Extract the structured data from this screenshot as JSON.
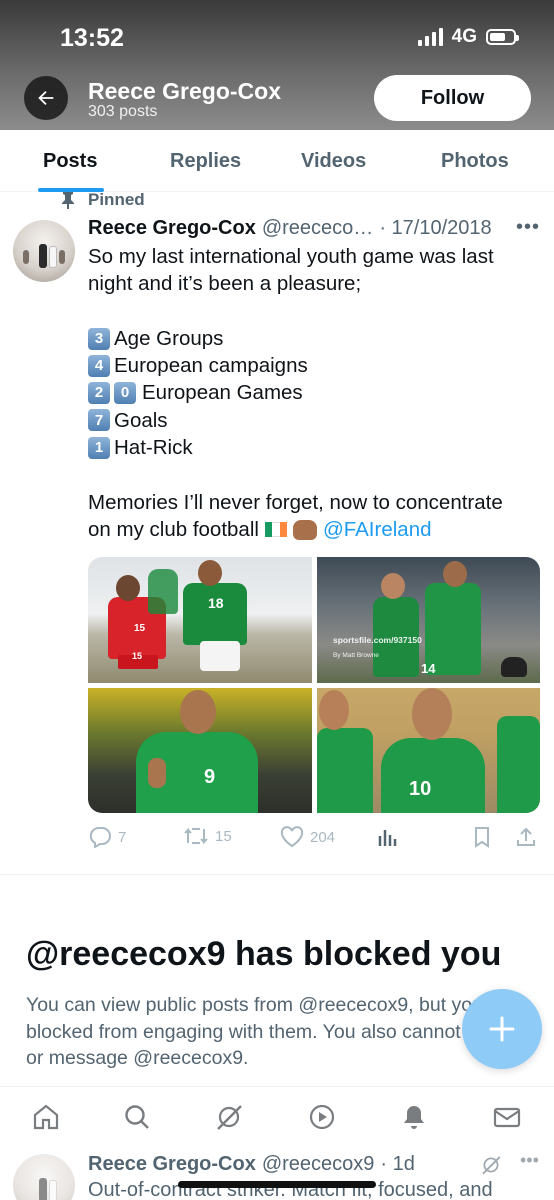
{
  "status_bar": {
    "time": "13:52",
    "network": "4G"
  },
  "header": {
    "name": "Reece Grego-Cox",
    "posts_count": "303 posts",
    "follow_label": "Follow"
  },
  "tabs": [
    {
      "label": "Posts",
      "active": true
    },
    {
      "label": "Replies",
      "active": false
    },
    {
      "label": "Videos",
      "active": false
    },
    {
      "label": "Photos",
      "active": false
    }
  ],
  "pinned_tweet": {
    "pinned_label": "Pinned",
    "author_name": "Reece Grego-Cox",
    "handle": "@reececo…",
    "date": "· 17/10/2018",
    "text_lines": {
      "l1": "So my last international youth game was last",
      "l2": "night and it’s been a pleasure;",
      "l3_num": "3",
      "l3": "Age Groups",
      "l4_num": "4",
      "l4": "European campaigns",
      "l5_num_a": "2",
      "l5_num_b": "0",
      "l5": "European Games",
      "l6_num": "7",
      "l6": "Goals",
      "l7_num": "1",
      "l7": "Hat-Rick",
      "l8": "Memories I’ll never forget, now to concentrate",
      "l9": "on my club football",
      "mention": "@FAIreland"
    },
    "media": {
      "photo1_numbers": [
        "15",
        "18",
        "15"
      ],
      "photo2_watermark": "sportsfile.com/937150",
      "photo2_credit": "By Matt Browne",
      "photo2_number": "14",
      "photo3_number": "9",
      "photo4_number": "10"
    },
    "stats": {
      "replies": "7",
      "reposts": "15",
      "likes": "204"
    }
  },
  "blocked_notice": {
    "title": "@reececox9 has blocked you",
    "body": "You can view public posts from @reececox9, but you are blocked from engaging with them. You also cannot follow or message @reececox9."
  },
  "next_tweet": {
    "author_name": "Reece Grego-Cox",
    "handle": "@reececox9",
    "time": "· 1d",
    "text": "Out-of-contract striker. Match fit, focused, and"
  },
  "colors": {
    "accent": "#1d9bf0",
    "fab": "#8ecbf7",
    "ireland_green": "#169b62",
    "ireland_orange": "#ff883e"
  },
  "icons": [
    "back-arrow-icon",
    "home-icon",
    "search-icon",
    "grok-icon",
    "spaces-icon",
    "notifications-bell-icon",
    "messages-envelope-icon",
    "compose-plus-icon"
  ]
}
